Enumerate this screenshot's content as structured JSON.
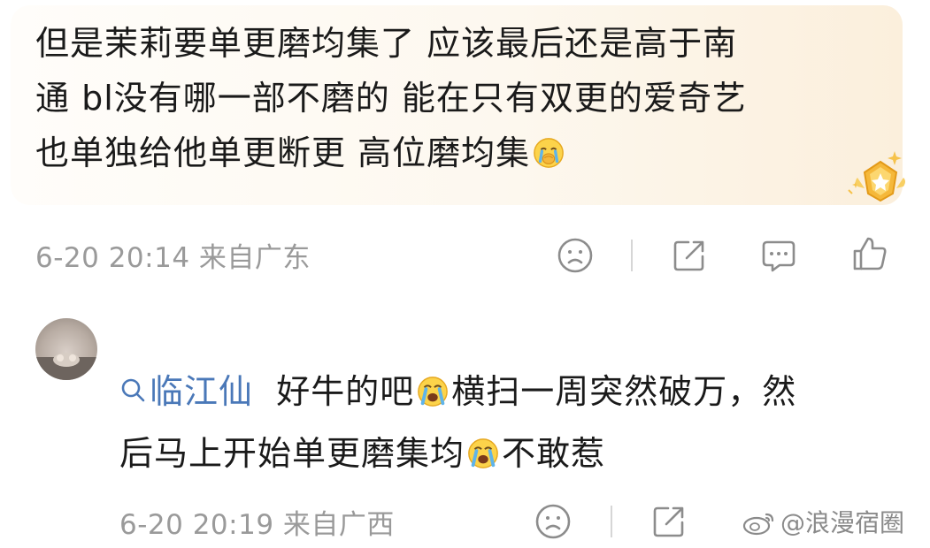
{
  "comments": [
    {
      "text_lines": [
        "但是茉莉要单更磨均集了 应该最后还是高于南",
        "通 bl没有哪一部不磨的 能在只有双更的爱奇艺",
        "也单独给他单更断更 高位磨均集"
      ],
      "emoji_icon": "crying-face-emoji",
      "time_location": "6-20 20:14 来自广东",
      "badge_icon": "gold-star-badge-icon"
    },
    {
      "mention": "临江仙",
      "text_part1": "好牛的吧",
      "text_part2": "横扫一周突然破万，然",
      "text_part3": "后马上开始单更磨集均",
      "text_part4": "不敢惹",
      "time_location": "6-20 20:19 来自广西"
    }
  ],
  "watermark": {
    "text": "@浪漫宿圈"
  },
  "icons": {
    "dislike": "frown-face-icon",
    "share": "share-box-icon",
    "comment": "comment-bubble-icon",
    "like": "thumbs-up-icon"
  },
  "colors": {
    "text": "#1a1a1a",
    "meta": "#9a9a9a",
    "mention": "#4a78b8",
    "badge_gold": "#f5b83a"
  }
}
